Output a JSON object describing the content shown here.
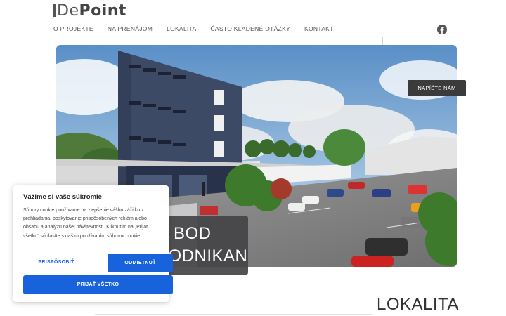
{
  "brand": {
    "logo_text_a": "De",
    "logo_text_b": "Point"
  },
  "nav": {
    "items": [
      {
        "label": "O PROJEKTE"
      },
      {
        "label": "NA PRENÁJOM"
      },
      {
        "label": "LOKALITA"
      },
      {
        "label": "ČASTO KLADENÉ OTÁZKY"
      },
      {
        "label": "KONTAKT"
      }
    ]
  },
  "social": {
    "icon": "facebook-icon"
  },
  "hero": {
    "contact_label": "NAPÍŠTE NÁM",
    "headline_line1": "BOD",
    "headline_line2": "PODNIKANIE"
  },
  "section": {
    "title": "LOKALITA"
  },
  "cookie": {
    "title": "Vážime si vaše súkromie",
    "text": "Súbory cookie používame na zlepšenie vášho zážitku z prehliadania, poskytovanie prispôsobených reklám alebo obsahu a analýzu našej návštevnosti. Kliknutím na „Prijať všetko“ súhlasíte s naším používaním súborov cookie.",
    "customize_label": "PRISPÔSOBIŤ",
    "reject_label": "ODMIETNUŤ",
    "accept_label": "PRIJAŤ VŠETKO"
  },
  "colors": {
    "accent": "#1863dc",
    "dark": "#3b3b3b",
    "building": "#3c4a66"
  }
}
